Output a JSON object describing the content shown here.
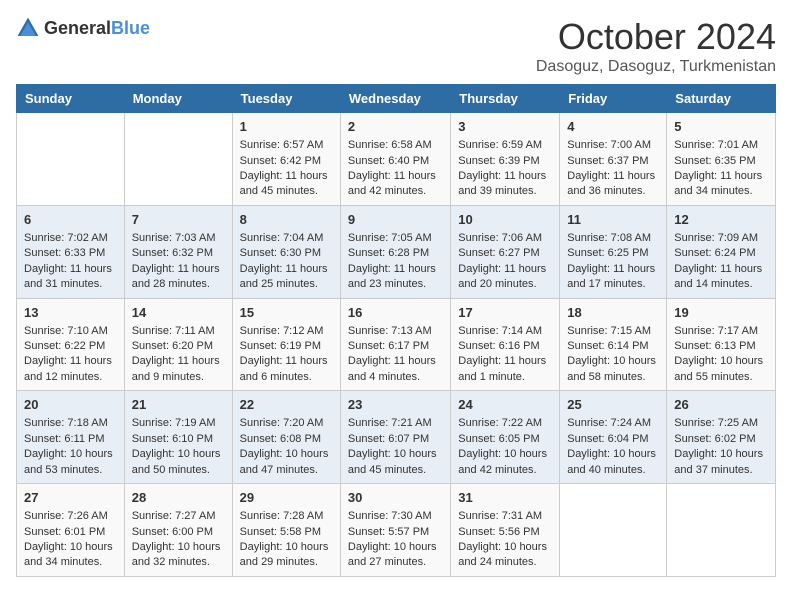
{
  "logo": {
    "general": "General",
    "blue": "Blue"
  },
  "title": "October 2024",
  "subtitle": "Dasoguz, Dasoguz, Turkmenistan",
  "days_of_week": [
    "Sunday",
    "Monday",
    "Tuesday",
    "Wednesday",
    "Thursday",
    "Friday",
    "Saturday"
  ],
  "weeks": [
    [
      {
        "day": "",
        "sunrise": "",
        "sunset": "",
        "daylight": ""
      },
      {
        "day": "",
        "sunrise": "",
        "sunset": "",
        "daylight": ""
      },
      {
        "day": "1",
        "sunrise": "Sunrise: 6:57 AM",
        "sunset": "Sunset: 6:42 PM",
        "daylight": "Daylight: 11 hours and 45 minutes."
      },
      {
        "day": "2",
        "sunrise": "Sunrise: 6:58 AM",
        "sunset": "Sunset: 6:40 PM",
        "daylight": "Daylight: 11 hours and 42 minutes."
      },
      {
        "day": "3",
        "sunrise": "Sunrise: 6:59 AM",
        "sunset": "Sunset: 6:39 PM",
        "daylight": "Daylight: 11 hours and 39 minutes."
      },
      {
        "day": "4",
        "sunrise": "Sunrise: 7:00 AM",
        "sunset": "Sunset: 6:37 PM",
        "daylight": "Daylight: 11 hours and 36 minutes."
      },
      {
        "day": "5",
        "sunrise": "Sunrise: 7:01 AM",
        "sunset": "Sunset: 6:35 PM",
        "daylight": "Daylight: 11 hours and 34 minutes."
      }
    ],
    [
      {
        "day": "6",
        "sunrise": "Sunrise: 7:02 AM",
        "sunset": "Sunset: 6:33 PM",
        "daylight": "Daylight: 11 hours and 31 minutes."
      },
      {
        "day": "7",
        "sunrise": "Sunrise: 7:03 AM",
        "sunset": "Sunset: 6:32 PM",
        "daylight": "Daylight: 11 hours and 28 minutes."
      },
      {
        "day": "8",
        "sunrise": "Sunrise: 7:04 AM",
        "sunset": "Sunset: 6:30 PM",
        "daylight": "Daylight: 11 hours and 25 minutes."
      },
      {
        "day": "9",
        "sunrise": "Sunrise: 7:05 AM",
        "sunset": "Sunset: 6:28 PM",
        "daylight": "Daylight: 11 hours and 23 minutes."
      },
      {
        "day": "10",
        "sunrise": "Sunrise: 7:06 AM",
        "sunset": "Sunset: 6:27 PM",
        "daylight": "Daylight: 11 hours and 20 minutes."
      },
      {
        "day": "11",
        "sunrise": "Sunrise: 7:08 AM",
        "sunset": "Sunset: 6:25 PM",
        "daylight": "Daylight: 11 hours and 17 minutes."
      },
      {
        "day": "12",
        "sunrise": "Sunrise: 7:09 AM",
        "sunset": "Sunset: 6:24 PM",
        "daylight": "Daylight: 11 hours and 14 minutes."
      }
    ],
    [
      {
        "day": "13",
        "sunrise": "Sunrise: 7:10 AM",
        "sunset": "Sunset: 6:22 PM",
        "daylight": "Daylight: 11 hours and 12 minutes."
      },
      {
        "day": "14",
        "sunrise": "Sunrise: 7:11 AM",
        "sunset": "Sunset: 6:20 PM",
        "daylight": "Daylight: 11 hours and 9 minutes."
      },
      {
        "day": "15",
        "sunrise": "Sunrise: 7:12 AM",
        "sunset": "Sunset: 6:19 PM",
        "daylight": "Daylight: 11 hours and 6 minutes."
      },
      {
        "day": "16",
        "sunrise": "Sunrise: 7:13 AM",
        "sunset": "Sunset: 6:17 PM",
        "daylight": "Daylight: 11 hours and 4 minutes."
      },
      {
        "day": "17",
        "sunrise": "Sunrise: 7:14 AM",
        "sunset": "Sunset: 6:16 PM",
        "daylight": "Daylight: 11 hours and 1 minute."
      },
      {
        "day": "18",
        "sunrise": "Sunrise: 7:15 AM",
        "sunset": "Sunset: 6:14 PM",
        "daylight": "Daylight: 10 hours and 58 minutes."
      },
      {
        "day": "19",
        "sunrise": "Sunrise: 7:17 AM",
        "sunset": "Sunset: 6:13 PM",
        "daylight": "Daylight: 10 hours and 55 minutes."
      }
    ],
    [
      {
        "day": "20",
        "sunrise": "Sunrise: 7:18 AM",
        "sunset": "Sunset: 6:11 PM",
        "daylight": "Daylight: 10 hours and 53 minutes."
      },
      {
        "day": "21",
        "sunrise": "Sunrise: 7:19 AM",
        "sunset": "Sunset: 6:10 PM",
        "daylight": "Daylight: 10 hours and 50 minutes."
      },
      {
        "day": "22",
        "sunrise": "Sunrise: 7:20 AM",
        "sunset": "Sunset: 6:08 PM",
        "daylight": "Daylight: 10 hours and 47 minutes."
      },
      {
        "day": "23",
        "sunrise": "Sunrise: 7:21 AM",
        "sunset": "Sunset: 6:07 PM",
        "daylight": "Daylight: 10 hours and 45 minutes."
      },
      {
        "day": "24",
        "sunrise": "Sunrise: 7:22 AM",
        "sunset": "Sunset: 6:05 PM",
        "daylight": "Daylight: 10 hours and 42 minutes."
      },
      {
        "day": "25",
        "sunrise": "Sunrise: 7:24 AM",
        "sunset": "Sunset: 6:04 PM",
        "daylight": "Daylight: 10 hours and 40 minutes."
      },
      {
        "day": "26",
        "sunrise": "Sunrise: 7:25 AM",
        "sunset": "Sunset: 6:02 PM",
        "daylight": "Daylight: 10 hours and 37 minutes."
      }
    ],
    [
      {
        "day": "27",
        "sunrise": "Sunrise: 7:26 AM",
        "sunset": "Sunset: 6:01 PM",
        "daylight": "Daylight: 10 hours and 34 minutes."
      },
      {
        "day": "28",
        "sunrise": "Sunrise: 7:27 AM",
        "sunset": "Sunset: 6:00 PM",
        "daylight": "Daylight: 10 hours and 32 minutes."
      },
      {
        "day": "29",
        "sunrise": "Sunrise: 7:28 AM",
        "sunset": "Sunset: 5:58 PM",
        "daylight": "Daylight: 10 hours and 29 minutes."
      },
      {
        "day": "30",
        "sunrise": "Sunrise: 7:30 AM",
        "sunset": "Sunset: 5:57 PM",
        "daylight": "Daylight: 10 hours and 27 minutes."
      },
      {
        "day": "31",
        "sunrise": "Sunrise: 7:31 AM",
        "sunset": "Sunset: 5:56 PM",
        "daylight": "Daylight: 10 hours and 24 minutes."
      },
      {
        "day": "",
        "sunrise": "",
        "sunset": "",
        "daylight": ""
      },
      {
        "day": "",
        "sunrise": "",
        "sunset": "",
        "daylight": ""
      }
    ]
  ]
}
